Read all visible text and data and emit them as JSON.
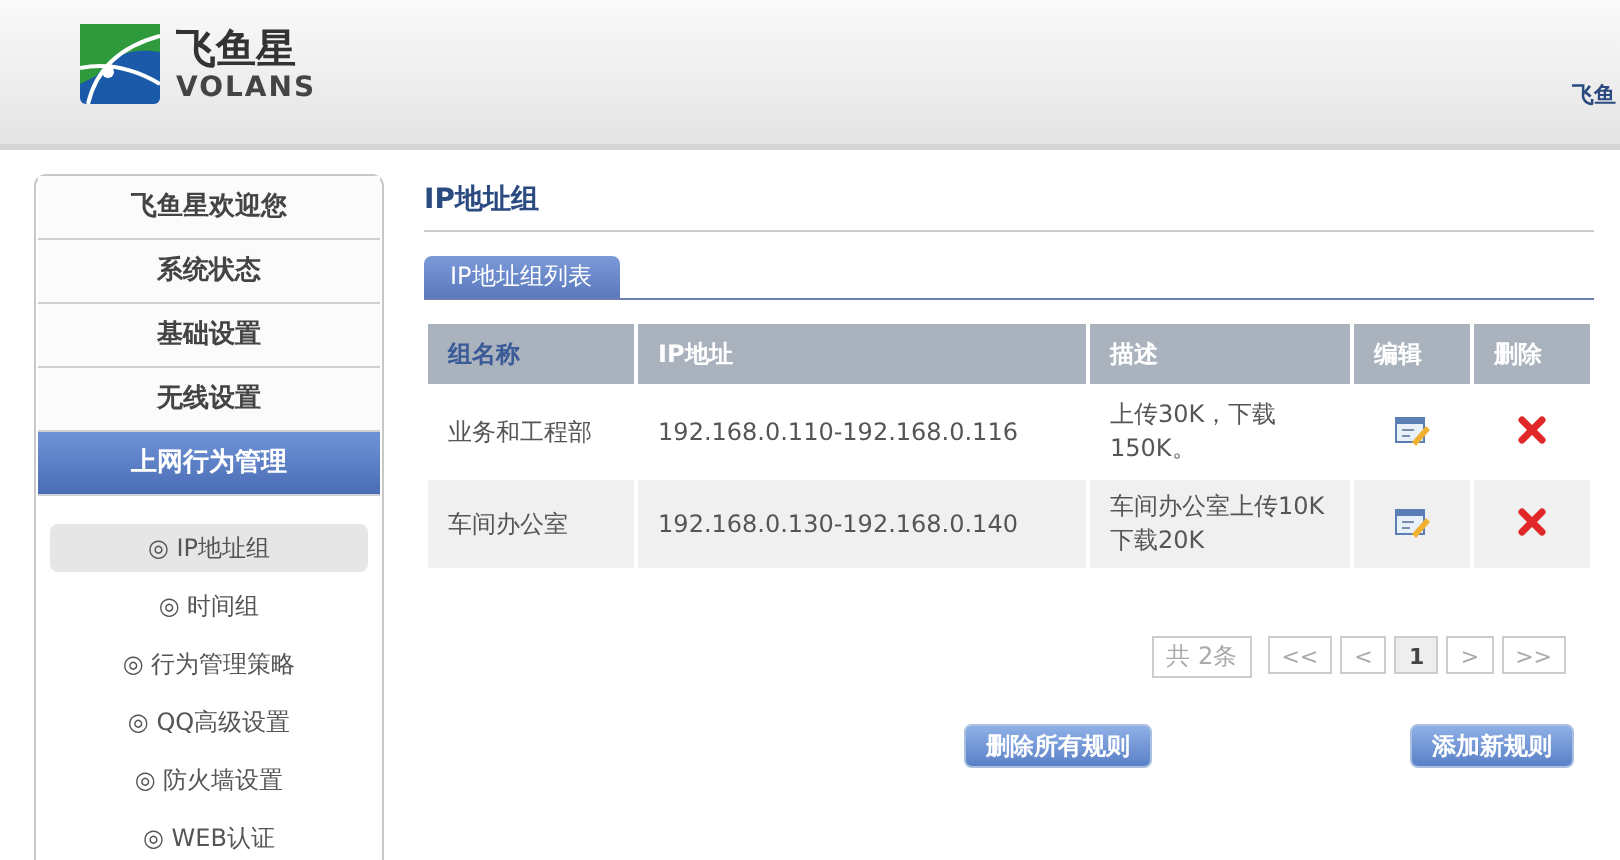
{
  "header": {
    "logo_cn": "飞鱼星",
    "logo_en": "VOLANS",
    "right_text": "飞鱼"
  },
  "sidebar": {
    "items": [
      {
        "label": "飞鱼星欢迎您",
        "selected": false
      },
      {
        "label": "系统状态",
        "selected": false
      },
      {
        "label": "基础设置",
        "selected": false
      },
      {
        "label": "无线设置",
        "selected": false
      },
      {
        "label": "上网行为管理",
        "selected": true
      }
    ],
    "subitems": [
      {
        "label": "◎ IP地址组",
        "selected": true
      },
      {
        "label": "◎ 时间组",
        "selected": false
      },
      {
        "label": "◎ 行为管理策略",
        "selected": false
      },
      {
        "label": "◎ QQ高级设置",
        "selected": false
      },
      {
        "label": "◎ 防火墙设置",
        "selected": false
      },
      {
        "label": "◎ WEB认证",
        "selected": false
      }
    ]
  },
  "page_title": "IP地址组",
  "tab": {
    "label": "IP地址组列表",
    "selected": true
  },
  "table": {
    "columns": [
      "组名称",
      "IP地址",
      "描述",
      "编辑",
      "删除"
    ],
    "rows": [
      {
        "name": "业务和工程部",
        "ip": "192.168.0.110-192.168.0.116",
        "description": "上传30K，下载150K。"
      },
      {
        "name": "车间办公室",
        "ip": "192.168.0.130-192.168.0.140",
        "description": "车间办公室上传10K下载20K"
      }
    ]
  },
  "pagination": {
    "total": "共 2条",
    "pages": [
      {
        "label": "<<",
        "selected": false
      },
      {
        "label": "<",
        "selected": false
      },
      {
        "label": "1",
        "selected": true
      },
      {
        "label": ">",
        "selected": false
      },
      {
        "label": ">>",
        "selected": false
      }
    ]
  },
  "buttons": [
    "删除所有规则",
    "添加新规则"
  ]
}
